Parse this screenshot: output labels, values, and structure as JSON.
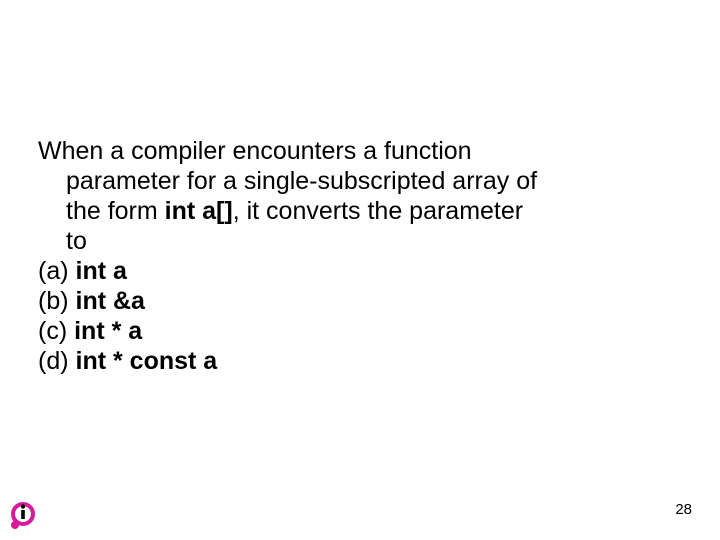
{
  "question": {
    "line1_pre": "When a compiler encounters a function",
    "line2": "parameter for a single-subscripted array of",
    "line3_pre": "the form ",
    "line3_bold": "int a[]",
    "line3_post": ", it converts the parameter",
    "line4": "to"
  },
  "options": {
    "a_pre": "(a) ",
    "a_bold": "int a",
    "b_pre": "(b) ",
    "b_bold": "int &a",
    "c_pre": "(c) ",
    "c_bold": "int * a",
    "d_pre": "(d) ",
    "d_bold": "int * const a"
  },
  "page_number": "28"
}
